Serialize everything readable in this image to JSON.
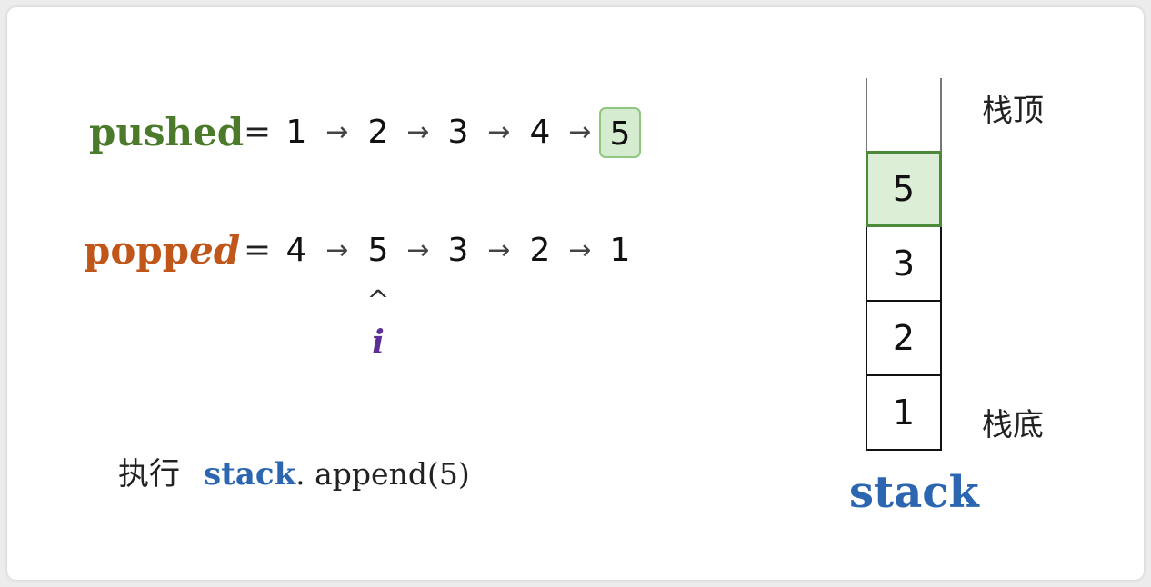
{
  "pushed": {
    "name": "pushed",
    "equals": "=",
    "values": [
      "1",
      "2",
      "3",
      "4",
      "5"
    ],
    "arrow": "→",
    "highlight_index": 4,
    "color": "#4a7a2a",
    "highlight_fill": "#d6ecd0",
    "highlight_border": "#8ec77f"
  },
  "popped": {
    "name_plain": "popp",
    "name_italic": "ed",
    "equals": "=",
    "values": [
      "4",
      "5",
      "3",
      "2",
      "1"
    ],
    "arrow": "→",
    "color": "#c0561a"
  },
  "pointer": {
    "caret": "^",
    "label": "i",
    "index": 1,
    "color": "#5f2d96"
  },
  "action": {
    "prefix": "执行",
    "object": "stack",
    "call": ". append(5)",
    "object_color": "#2c66b0"
  },
  "stack": {
    "title": "stack",
    "top_label": "栈顶",
    "bottom_label": "栈底",
    "items_top_to_bottom": [
      "5",
      "3",
      "2",
      "1"
    ],
    "new_item_fill": "#dcefd6",
    "new_item_border": "#4a8a3a",
    "title_color": "#2c66b0"
  }
}
